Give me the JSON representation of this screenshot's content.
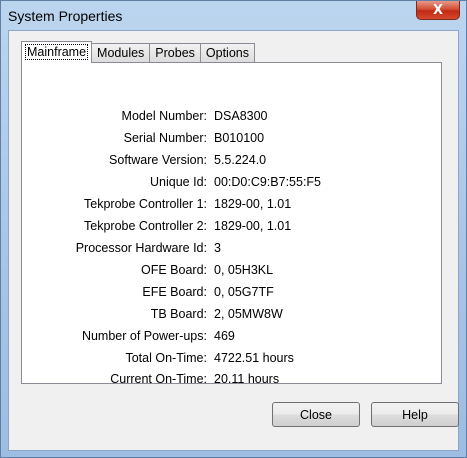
{
  "window": {
    "title": "System Properties",
    "close_glyph": "X"
  },
  "tabs": [
    {
      "label": "Mainframe",
      "active": true
    },
    {
      "label": "Modules",
      "active": false
    },
    {
      "label": "Probes",
      "active": false
    },
    {
      "label": "Options",
      "active": false
    }
  ],
  "properties": [
    {
      "label": "Model Number:",
      "value": "DSA8300"
    },
    {
      "label": "Serial Number:",
      "value": "B010100"
    },
    {
      "label": "Software Version:",
      "value": "5.5.224.0"
    },
    {
      "label": "Unique Id:",
      "value": "00:D0:C9:B7:55:F5"
    },
    {
      "label": "Tekprobe Controller 1:",
      "value": "1829-00, 1.01"
    },
    {
      "label": "Tekprobe Controller 2:",
      "value": "1829-00, 1.01"
    },
    {
      "label": "Processor Hardware Id:",
      "value": "3"
    },
    {
      "label": "OFE Board:",
      "value": "0, 05H3KL"
    },
    {
      "label": "EFE Board:",
      "value": "0, 05G7TF"
    },
    {
      "label": "TB Board:",
      "value": "2, 05MW8W"
    },
    {
      "label": "Number of Power-ups:",
      "value": "469"
    },
    {
      "label": "Total On-Time:",
      "value": "4722.51 hours"
    },
    {
      "label": "Current On-Time:",
      "value": "20.11 hours"
    }
  ],
  "buttons": {
    "close": "Close",
    "help": "Help"
  }
}
